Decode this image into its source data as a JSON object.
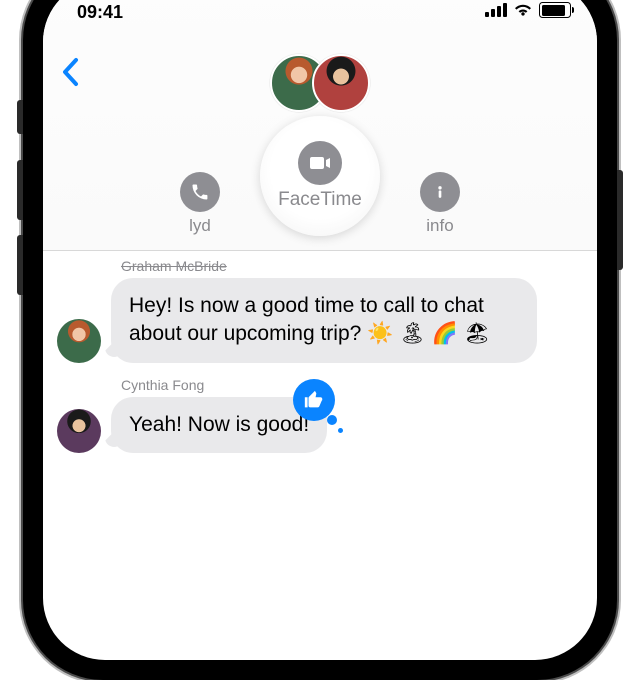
{
  "status": {
    "time": "09:41"
  },
  "header": {
    "actions": {
      "audio": {
        "label": "lyd"
      },
      "facetime": {
        "label": "FaceTime"
      },
      "info": {
        "label": "info"
      }
    }
  },
  "thread": {
    "messages": [
      {
        "sender": "Graham McBride",
        "text": "Hey! Is now a good time to call to chat about our upcoming trip? ☀️ 🏝 🌈 🏖",
        "avatar": "avA"
      },
      {
        "sender": "Cynthia Fong",
        "text": "Yeah! Now is good!",
        "avatar": "avC",
        "tapback": "thumbs-up"
      }
    ]
  },
  "colors": {
    "accent": "#0a84ff",
    "secondary": "#8e8e93",
    "bubble": "#e9e9eb"
  }
}
